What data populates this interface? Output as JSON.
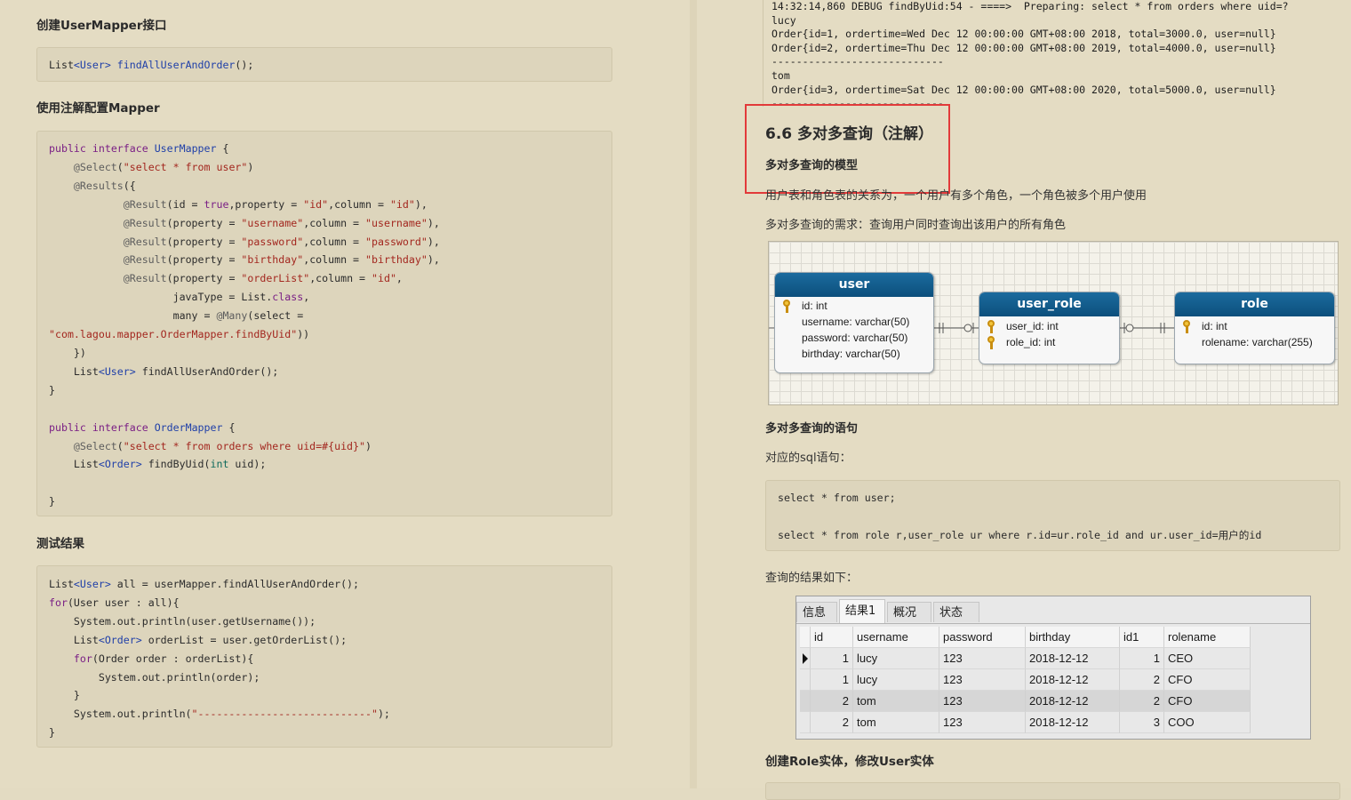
{
  "left": {
    "h1": "创建UserMapper接口",
    "h2": "使用注解配置Mapper",
    "h3": "测试结果"
  },
  "right": {
    "console_lines": [
      "14:32:14,860 DEBUG findByUid:54 - ====>  Preparing: select * from orders where uid=?",
      "lucy",
      "Order{id=1, ordertime=Wed Dec 12 00:00:00 GMT+08:00 2018, total=3000.0, user=null}",
      "Order{id=2, ordertime=Thu Dec 12 00:00:00 GMT+08:00 2019, total=4000.0, user=null}",
      "----------------------------",
      "tom",
      "Order{id=3, ordertime=Sat Dec 12 00:00:00 GMT+08:00 2020, total=5000.0, user=null}",
      "----------------------------"
    ],
    "section_title": "6.6 多对多查询（注解）",
    "model_heading": "多对多查询的模型",
    "relation_text": "用户表和角色表的关系为，一个用户有多个角色，一个角色被多个用户使用",
    "requirement_text": "多对多查询的需求：查询用户同时查询出该用户的所有角色",
    "statement_heading": "多对多查询的语句",
    "sql_intro": "对应的sql语句：",
    "sql_line1": "select * from user;",
    "sql_line2": "select * from role r,user_role ur where r.id=ur.role_id and ur.user_id=用户的id",
    "result_intro": "查询的结果如下：",
    "next_heading": "创建Role实体，修改User实体"
  },
  "er_diagram": {
    "entities": [
      {
        "name": "user",
        "fields": [
          {
            "text": "id: int",
            "key": true
          },
          {
            "text": "username: varchar(50)",
            "key": false
          },
          {
            "text": "password: varchar(50)",
            "key": false
          },
          {
            "text": "birthday: varchar(50)",
            "key": false
          }
        ]
      },
      {
        "name": "user_role",
        "fields": [
          {
            "text": "user_id: int",
            "key": true
          },
          {
            "text": "role_id: int",
            "key": true
          }
        ]
      },
      {
        "name": "role",
        "fields": [
          {
            "text": "id: int",
            "key": true
          },
          {
            "text": "rolename: varchar(255)",
            "key": false
          }
        ]
      }
    ]
  },
  "result_grid": {
    "tabs": [
      "信息",
      "结果1",
      "概况",
      "状态"
    ],
    "active_tab": "结果1",
    "columns": [
      "id",
      "username",
      "password",
      "birthday",
      "id1",
      "rolename"
    ],
    "rows": [
      [
        "1",
        "lucy",
        "123",
        "2018-12-12",
        "1",
        "CEO"
      ],
      [
        "1",
        "lucy",
        "123",
        "2018-12-12",
        "2",
        "CFO"
      ],
      [
        "2",
        "tom",
        "123",
        "2018-12-12",
        "2",
        "CFO"
      ],
      [
        "2",
        "tom",
        "123",
        "2018-12-12",
        "3",
        "COO"
      ]
    ]
  },
  "colors": {
    "page_bg": "#e4dcc3",
    "code_bg": "#ddd5bc",
    "highlight_border": "#e23a3a",
    "entity_header": "#0c4f7c",
    "keyword": "#7a1f85",
    "type": "#1f3fa8",
    "string": "#a3271f"
  }
}
